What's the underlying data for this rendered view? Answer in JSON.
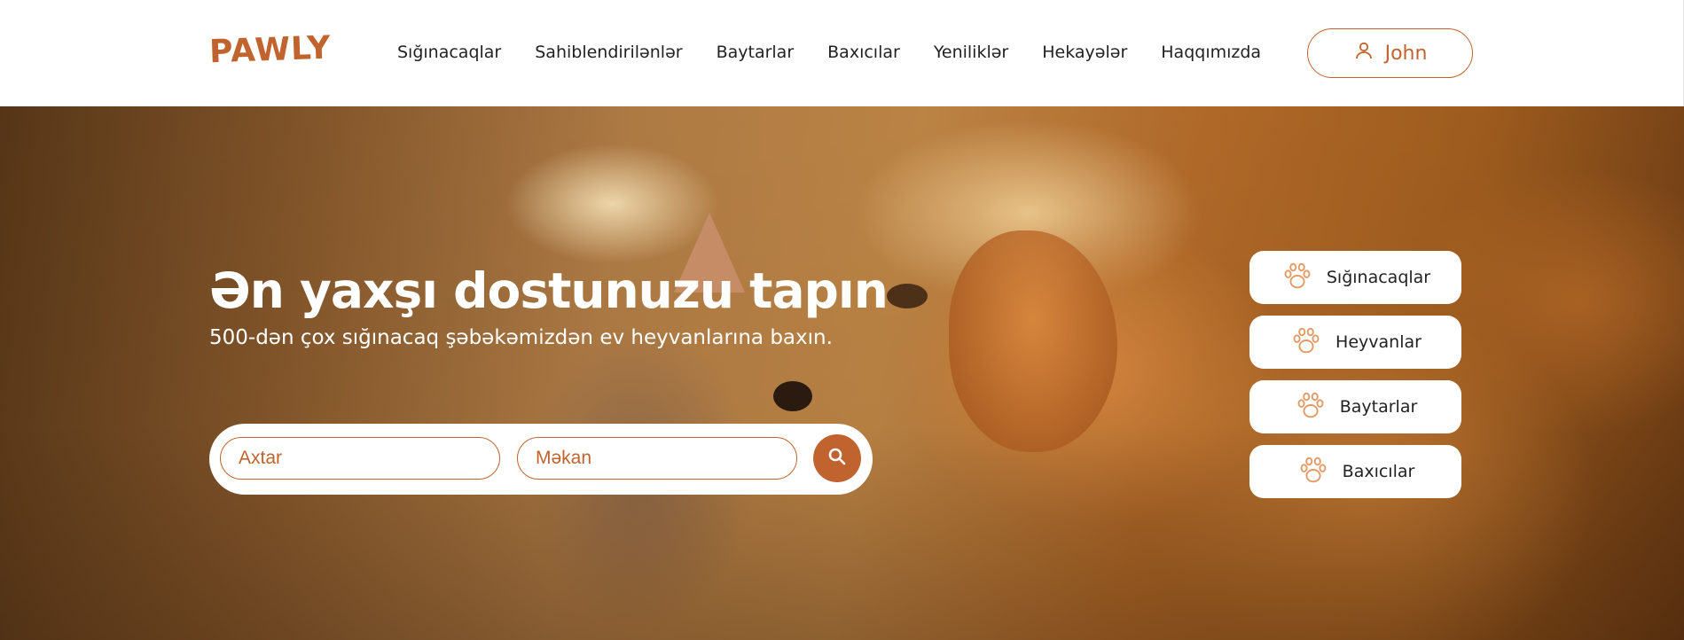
{
  "header": {
    "logo": "PAWLY",
    "nav": [
      {
        "label": "Sığınacaqlar"
      },
      {
        "label": "Sahiblendirilənlər"
      },
      {
        "label": "Baytarlar"
      },
      {
        "label": "Baxıcılar"
      },
      {
        "label": "Yeniliklər"
      },
      {
        "label": "Hekayələr"
      },
      {
        "label": "Haqqımızda"
      }
    ],
    "user": {
      "name": "John",
      "icon": "user-icon"
    }
  },
  "hero": {
    "title": "Ən yaxşı dostunuzu tapın",
    "subtitle": "500-dən çox sığınacaq şəbəkəmizdən ev heyvanlarına baxın.",
    "search": {
      "query_placeholder": "Axtar",
      "location_placeholder": "Məkan",
      "button_icon": "search-icon"
    },
    "quick_links": [
      {
        "label": "Sığınacaqlar",
        "icon": "paw-icon"
      },
      {
        "label": "Heyvanlar",
        "icon": "paw-icon"
      },
      {
        "label": "Baytarlar",
        "icon": "paw-icon"
      },
      {
        "label": "Baxıcılar",
        "icon": "paw-icon"
      }
    ]
  },
  "colors": {
    "accent": "#c0632e",
    "text": "#222222",
    "background": "#ffffff"
  }
}
